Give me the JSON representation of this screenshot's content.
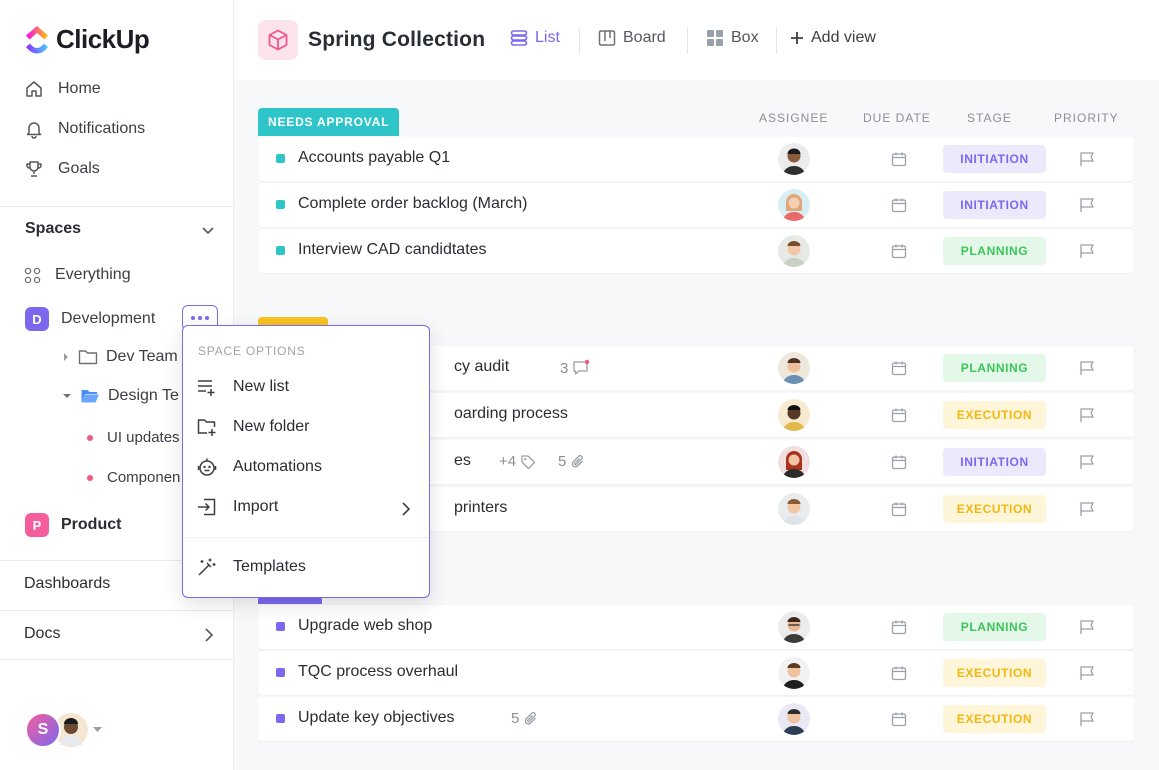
{
  "app": {
    "logo_text": "ClickUp"
  },
  "nav": {
    "home": "Home",
    "notifications": "Notifications",
    "goals": "Goals"
  },
  "spaces": {
    "title": "Spaces",
    "everything": "Everything",
    "development": {
      "badge": "D",
      "label": "Development",
      "color": "#7b68ee"
    },
    "dev_team": "Dev Team",
    "design_team": "Design Te",
    "ui_updates": "UI updates",
    "components": "Componen",
    "product": {
      "badge": "P",
      "label": "Product",
      "color": "#f55d9c"
    }
  },
  "footer_nav": {
    "dashboards": "Dashboards",
    "docs": "Docs"
  },
  "user": {
    "initial": "S"
  },
  "header": {
    "title": "Spring Collection",
    "views": {
      "list": "List",
      "board": "Board",
      "box": "Box",
      "add_view": "Add view"
    }
  },
  "columns": {
    "assignee": "ASSIGNEE",
    "due_date": "DUE DATE",
    "stage": "STAGE",
    "priority": "PRIORITY"
  },
  "groups": {
    "needs_approval": {
      "label": "NEEDS APPROVAL",
      "color": "#2ec5c9"
    },
    "second": {
      "color": "#f8c21d"
    },
    "third": {
      "color": "#7b68ee"
    }
  },
  "stages": {
    "initiation": {
      "label": "INITIATION",
      "bg": "#ece9fd",
      "fg": "#7b68ee"
    },
    "planning": {
      "label": "PLANNING",
      "bg": "#e3f8e8",
      "fg": "#3cc65a"
    },
    "execution": {
      "label": "EXECUTION",
      "bg": "#fff6d9",
      "fg": "#f2b70d"
    }
  },
  "tasks": [
    {
      "name": "Accounts payable Q1"
    },
    {
      "name": "Complete order backlog (March)"
    },
    {
      "name": "Interview CAD candidtates"
    },
    {
      "name": "cy audit",
      "comments": "3"
    },
    {
      "name": "oarding process"
    },
    {
      "name": "es",
      "tags": "+4",
      "attachments": "5"
    },
    {
      "name": "printers"
    },
    {
      "name": "Upgrade web shop"
    },
    {
      "name": "TQC process overhaul"
    },
    {
      "name": "Update key objectives",
      "attachments": "5"
    }
  ],
  "dropdown": {
    "title": "SPACE OPTIONS",
    "new_list": "New list",
    "new_folder": "New folder",
    "automations": "Automations",
    "import": "Import",
    "templates": "Templates"
  }
}
